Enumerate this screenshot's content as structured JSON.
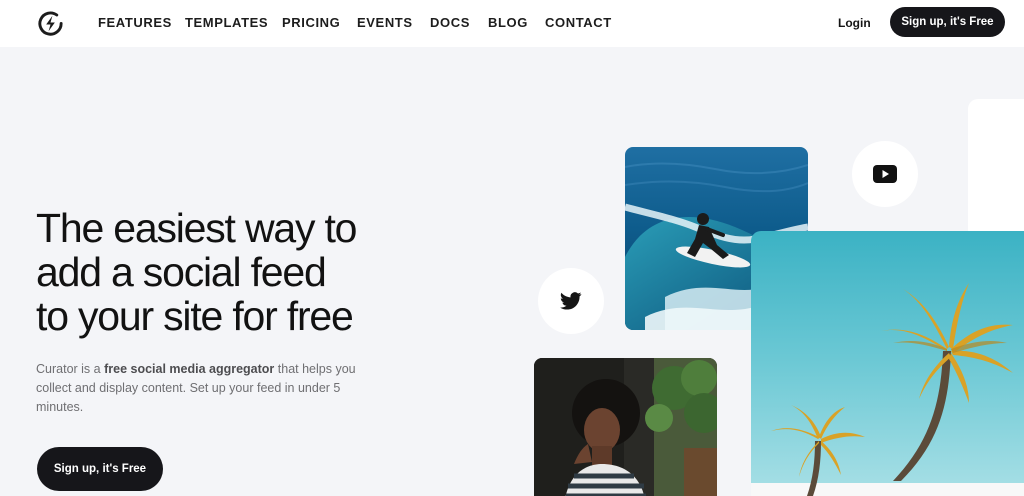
{
  "nav": {
    "items": [
      "FEATURES",
      "TEMPLATES",
      "PRICING",
      "EVENTS",
      "DOCS",
      "BLOG",
      "CONTACT"
    ],
    "login_label": "Login",
    "signup_label": "Sign up, it's Free"
  },
  "hero": {
    "title_lines": [
      "The easiest way to",
      "add a social feed",
      "to your site for free"
    ],
    "desc_pre": "Curator is a ",
    "desc_bold": "free social media aggregator",
    "desc_post": " that helps you collect and display content. Set up your feed in under 5 minutes.",
    "cta_label": "Sign up, it's Free"
  },
  "collage": {
    "images": [
      "surfer-photo",
      "portrait-photo",
      "palm-trees-photo"
    ],
    "icons": [
      "twitter-icon",
      "youtube-icon"
    ]
  },
  "colors": {
    "dark": "#16161a",
    "background": "#f4f5f8",
    "white": "#ffffff"
  }
}
